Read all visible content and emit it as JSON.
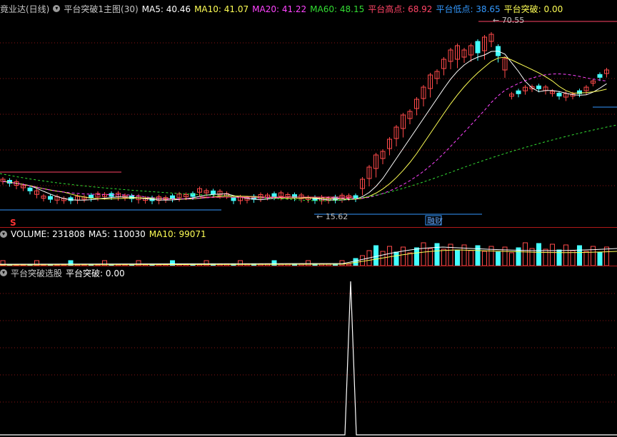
{
  "main_header": {
    "stock_name": "竟业达(日线)",
    "formula": "平台突破1主图(30)",
    "items": [
      {
        "label": "MA5",
        "value": "40.46",
        "color": "#ffffff"
      },
      {
        "label": "MA10",
        "value": "41.07",
        "color": "#ffff55"
      },
      {
        "label": "MA20",
        "value": "41.22",
        "color": "#ff44ff"
      },
      {
        "label": "MA60",
        "value": "48.15",
        "color": "#33dd33"
      },
      {
        "label": "平台高点",
        "value": "68.92",
        "color": "#ff4466"
      },
      {
        "label": "平台低点",
        "value": "38.65",
        "color": "#3399ff"
      },
      {
        "label": "平台突破",
        "value": "0.00",
        "color": "#ffff55"
      }
    ]
  },
  "price_annotations": {
    "high": "70.55",
    "low": "15.62",
    "badge": "融财",
    "marker": "S"
  },
  "volume_header": {
    "items": [
      {
        "label": "VOLUME",
        "value": "231808",
        "color": "#ffffff"
      },
      {
        "label": "MA5",
        "value": "110030",
        "color": "#ffffff"
      },
      {
        "label": "MA10",
        "value": "99071",
        "color": "#ffff55"
      }
    ]
  },
  "indicator_header": {
    "title": "平台突破选股",
    "items": [
      {
        "label": "平台突破",
        "value": "0.00",
        "color": "#ffffff"
      }
    ]
  },
  "colors": {
    "up": "#ff4a4a",
    "down": "#44ffff",
    "grid": "#8a1414",
    "separator": "#b01818"
  }
}
